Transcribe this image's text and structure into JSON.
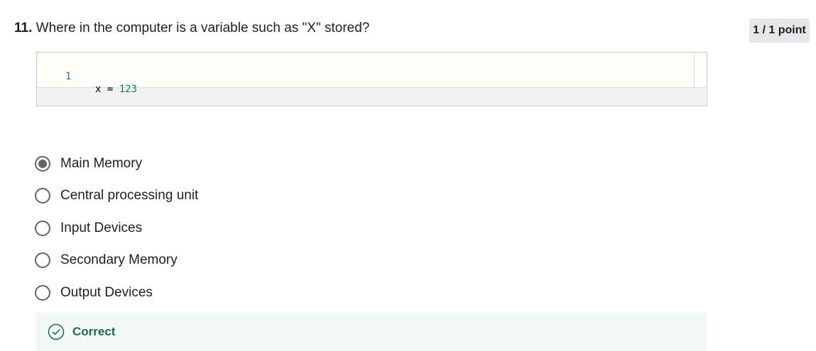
{
  "question": {
    "number": "11.",
    "text": "Where in the computer is a variable such as \"X\" stored?"
  },
  "score": {
    "label": "1 / 1 point"
  },
  "code": {
    "line_number": "1",
    "code_var": "x = ",
    "code_value": "123"
  },
  "options": [
    {
      "label": "Main Memory",
      "selected": true
    },
    {
      "label": "Central processing unit",
      "selected": false
    },
    {
      "label": "Input Devices",
      "selected": false
    },
    {
      "label": "Secondary Memory",
      "selected": false
    },
    {
      "label": "Output Devices",
      "selected": false
    }
  ],
  "feedback": {
    "status": "Correct",
    "icon": "check-circle-icon",
    "color": "#1e6e45"
  }
}
